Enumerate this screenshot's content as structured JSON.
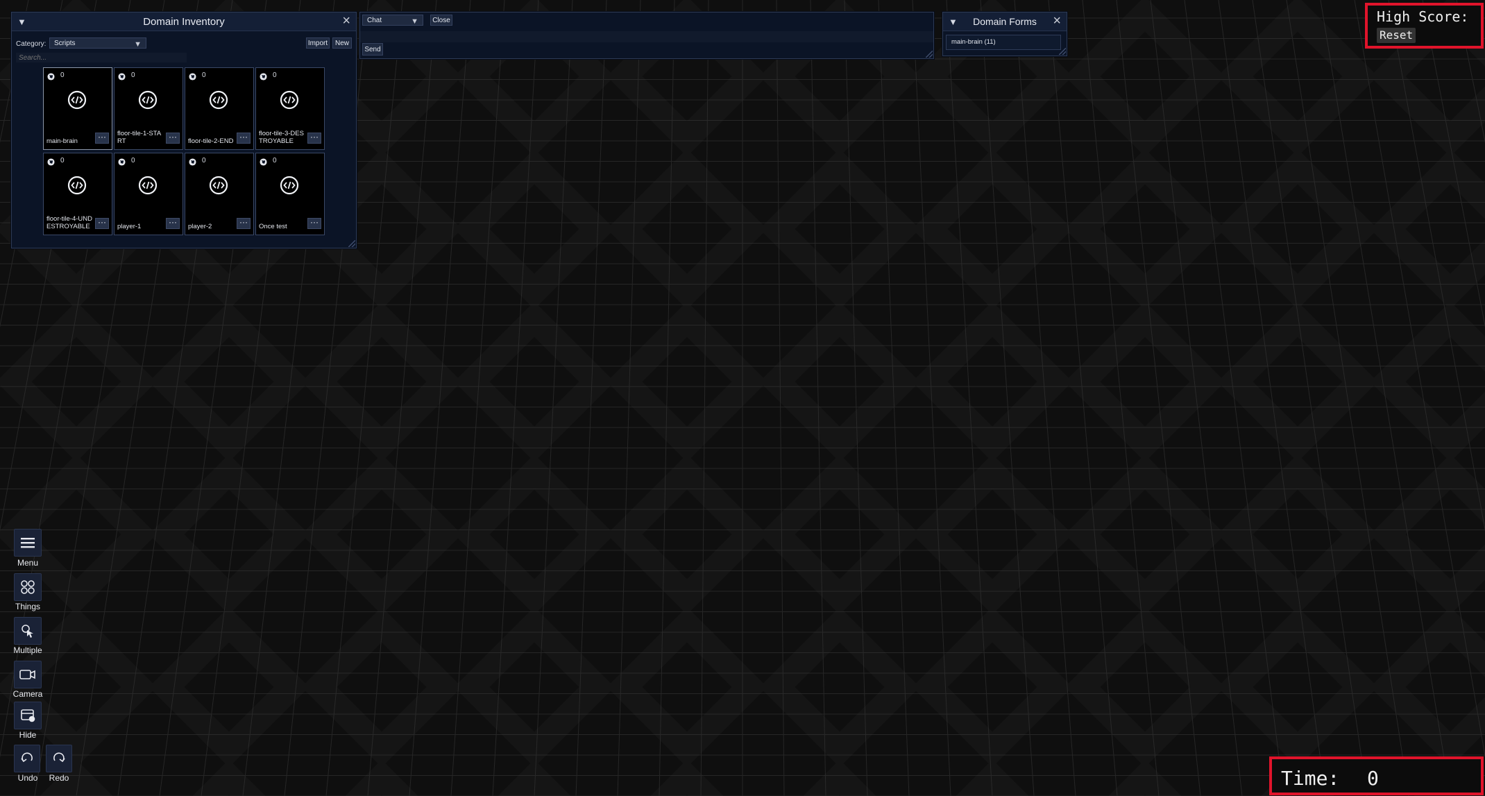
{
  "domain_inventory": {
    "title": "Domain Inventory",
    "category_label": "Category:",
    "category_value": "Scripts",
    "import_label": "Import",
    "new_label": "New",
    "search_placeholder": "Search...",
    "items": [
      {
        "name": "main-brain",
        "count": "0"
      },
      {
        "name": "floor-tile-1-START",
        "count": "0"
      },
      {
        "name": "floor-tile-2-END",
        "count": "0"
      },
      {
        "name": "floor-tile-3-DESTROYABLE",
        "count": "0"
      },
      {
        "name": "floor-tile-4-UNDESTROYABLE",
        "count": "0"
      },
      {
        "name": "player-1",
        "count": "0"
      },
      {
        "name": "player-2",
        "count": "0"
      },
      {
        "name": "Once test",
        "count": "0"
      }
    ]
  },
  "chat": {
    "channel": "Chat",
    "close_label": "Close",
    "send_label": "Send"
  },
  "domain_forms": {
    "title": "Domain Forms",
    "item": "main-brain (11)"
  },
  "toolbar": {
    "menu": "Menu",
    "things": "Things",
    "multiple": "Multiple",
    "camera": "Camera",
    "hide": "Hide",
    "undo": "Undo",
    "redo": "Redo"
  },
  "hud": {
    "high_score_label": "High Score:",
    "reset_label": "Reset",
    "time_label": "Time:",
    "time_value": "0",
    "accent_color": "#e0142b"
  }
}
